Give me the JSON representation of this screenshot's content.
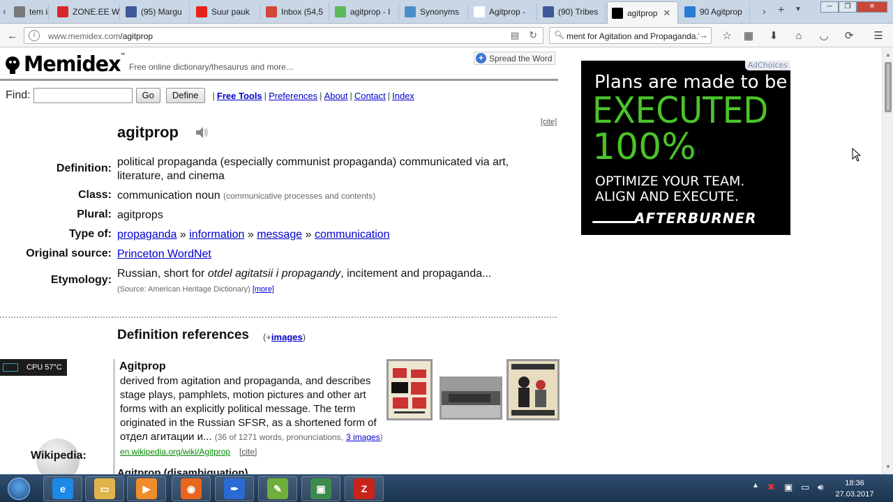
{
  "browser": {
    "tabs": [
      {
        "label": "tem info",
        "fav": "globe-favicon",
        "color": "#7a7a7a"
      },
      {
        "label": "ZONE.EE W",
        "fav": "zone-favicon",
        "color": "#d9262c"
      },
      {
        "label": "(95) Margu",
        "fav": "facebook-favicon",
        "color": "#3b5998"
      },
      {
        "label": "Suur pauk",
        "fav": "youtube-favicon",
        "color": "#e62117"
      },
      {
        "label": "Inbox (54,5",
        "fav": "gmail-favicon",
        "color": "#d44638"
      },
      {
        "label": "agitprop - I",
        "fav": "check-favicon",
        "color": "#5cb85c"
      },
      {
        "label": "Synonyms",
        "fav": "sy-favicon",
        "color": "#4a90c8"
      },
      {
        "label": "Agitprop -",
        "fav": "wikipedia-favicon",
        "color": "#ffffff"
      },
      {
        "label": "(90) Tribes",
        "fav": "facebook-favicon",
        "color": "#3b5998"
      },
      {
        "label": "agitprop",
        "fav": "memidex-favicon",
        "color": "#000000"
      },
      {
        "label": "90 Agitprop",
        "fav": "p-favicon",
        "color": "#2a7bd4"
      }
    ],
    "url_host": "www.memidex.com",
    "url_path": "/agitprop",
    "search_value": "ment for Agitation and Propaganda.\""
  },
  "site": {
    "name": "Memidex",
    "tm": "™",
    "tagline": "Free online dictionary/thesaurus and more...",
    "spread": "Spread the Word",
    "find_label": "Find:",
    "find_value": "",
    "go": "Go",
    "define": "Define",
    "links": [
      "Free Tools",
      "Preferences",
      "About",
      "Contact",
      "Index"
    ]
  },
  "entry": {
    "cite": "[cite]",
    "headword": "agitprop",
    "definition_label": "Definition:",
    "definition": "political propaganda (especially communist propaganda) communicated via art, literature, and cinema",
    "class_label": "Class:",
    "class_value": "communication noun",
    "class_note": "(communicative processes and contents)",
    "plural_label": "Plural:",
    "plural": "agitprops",
    "typeof_label": "Type of:",
    "typeof": [
      "propaganda",
      "information",
      "message",
      "communication"
    ],
    "typeof_sep": "»",
    "source_label": "Original source:",
    "source": "Princeton WordNet",
    "etym_label": "Etymology:",
    "etym_pre": "Russian, short for ",
    "etym_italic": "otdel agitatsii i propagandy",
    "etym_post": ", incitement and propaganda...",
    "etym_source": "(Source: American Heritage Dictionary)",
    "etym_more": "[more]"
  },
  "refs": {
    "heading": "Definition references",
    "images_pre": "(+",
    "images_link": "images",
    "images_post": ")",
    "wiki_label": "Wikipedia:",
    "item1_title": "Agitprop",
    "item1_text": "derived from agitation and propaganda, and describes stage plays, pamphlets, motion pictures and other art forms with an explicitly political message. The term originated in the Russian SFSR, as a shortened form of отдел агитации и...",
    "item1_stats": "(36 of 1271 words, pronunciations,",
    "item1_images": "3 images",
    "item1_close": ")",
    "item1_link": "en.wikipedia.org/wiki/Agitprop",
    "item1_cite": "[cite]",
    "item2_title": "Agitprop (disambiguation)"
  },
  "ad": {
    "adchoices": "AdChoices",
    "line1": "Plans are made to be",
    "line2": "EXECUTED",
    "line3": "100%",
    "line4a": "OPTIMIZE YOUR TEAM.",
    "line4b": "ALIGN AND EXECUTE.",
    "brand": "AFTERBURNER",
    "green": "#4bc32a"
  },
  "overlay": {
    "cpu": "CPU 57°C"
  },
  "taskbar": {
    "time": "18:36",
    "date": "27.03.2017",
    "apps": [
      {
        "name": "ie-icon",
        "glyph": "e",
        "color": "#1e88e5"
      },
      {
        "name": "explorer-icon",
        "glyph": "▭",
        "color": "#e0b44a"
      },
      {
        "name": "media-player-icon",
        "glyph": "▶",
        "color": "#f08c2a"
      },
      {
        "name": "firefox-icon",
        "glyph": "◉",
        "color": "#e8661e"
      },
      {
        "name": "pen-app-icon",
        "glyph": "✒",
        "color": "#2a6ad4"
      },
      {
        "name": "notepad-chart-icon",
        "glyph": "✎",
        "color": "#6fae3c"
      },
      {
        "name": "monitor-app-icon",
        "glyph": "▣",
        "color": "#3c8a4e"
      },
      {
        "name": "filezilla-icon",
        "glyph": "Z",
        "color": "#c8241c"
      }
    ]
  }
}
